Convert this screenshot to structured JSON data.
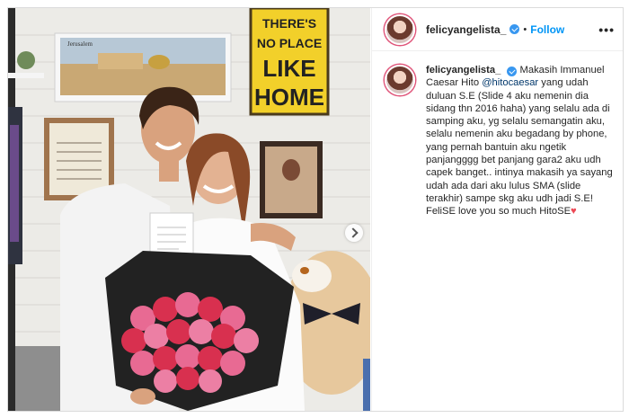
{
  "post": {
    "username": "felicyangelista_",
    "separator": "•",
    "follow_label": "Follow",
    "more_label": "•••",
    "caption_part1": "Makasih Immanuel Caesar Hito ",
    "mention": "@hitocaesar",
    "caption_part2": " yang udah duluan S.E (Slide 4 aku nemenin dia sidang thn 2016 haha) yang selalu ada di samping aku, yg selalu semangatin aku, selalu nemenin aku begadang by phone, yang pernah bantuin aku ngetik panjangggg bet panjang gara2 aku udh capek banget.. intinya makasih ya sayang udah ada dari aku lulus SMA (slide terakhir) sampe skg aku udh jadi S.E! FeliSE love you so much HitoSE",
    "heart": "♥"
  },
  "photo": {
    "sign_lines": [
      "THERE'S",
      "NO PLACE",
      "LIKE",
      "HOME"
    ],
    "poster_label": "Jerusalem"
  }
}
